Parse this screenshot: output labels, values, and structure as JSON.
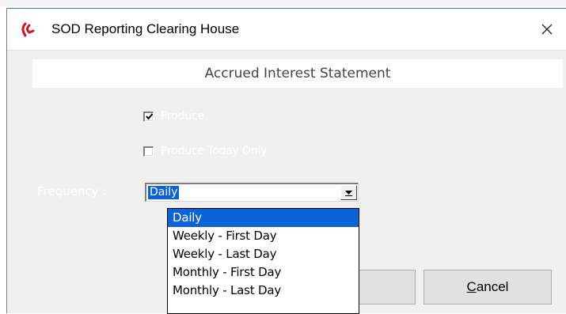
{
  "window": {
    "title": "SOD Reporting Clearing House",
    "app_icon": "app-logo-icon",
    "close_icon": "close-icon"
  },
  "header": {
    "title": "Accrued Interest Statement"
  },
  "options": {
    "produce": {
      "label": "Produce",
      "checked": true
    },
    "produce_today_only": {
      "label": "Produce Today Only",
      "checked": false
    }
  },
  "frequency": {
    "label": "Frequency :",
    "selected": "Daily",
    "options": [
      "Daily",
      "Weekly - First Day",
      "Weekly - Last Day",
      "Monthly - First Day",
      "Monthly - Last Day"
    ]
  },
  "buttons": {
    "ok_label": "",
    "cancel_label": "Cancel"
  },
  "colors": {
    "accent": "#0a64d8",
    "logo_red": "#d1131f",
    "dialog_bg": "#f0f0f0"
  }
}
